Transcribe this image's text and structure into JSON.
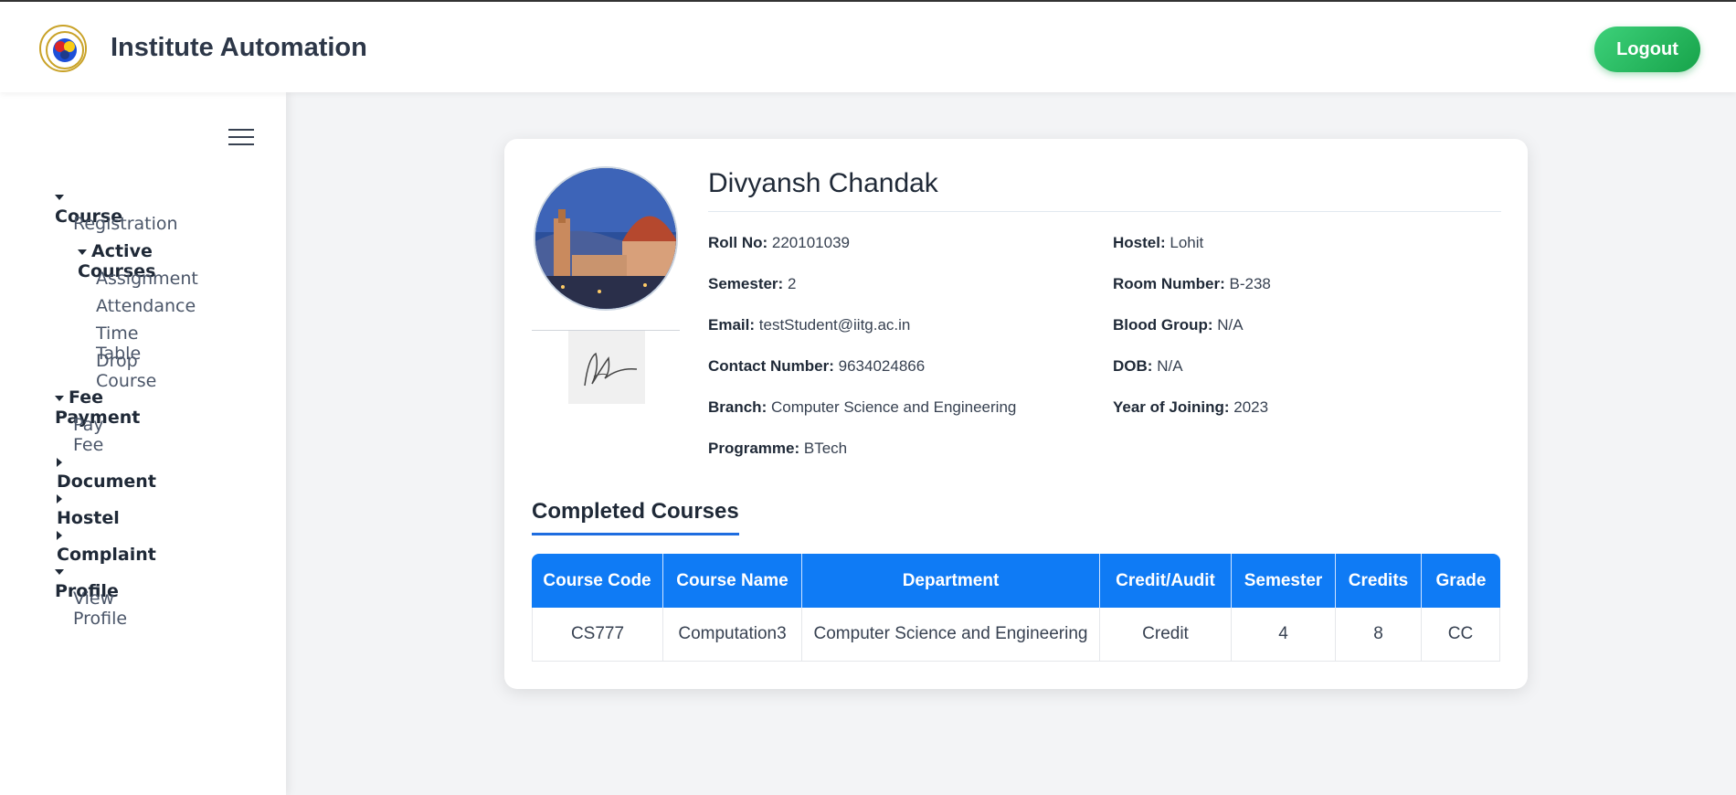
{
  "header": {
    "title": "Institute Automation",
    "logout_label": "Logout"
  },
  "sidebar": {
    "groups": [
      {
        "label": "Course",
        "expanded": true,
        "items": [
          "Registration"
        ],
        "subgroup": {
          "label": "Active Courses",
          "expanded": true,
          "items": [
            "Assignment",
            "Attendance",
            "Time Table",
            "Drop Course"
          ]
        }
      },
      {
        "label": "Fee Payment",
        "expanded": true,
        "items": [
          "Pay Fee"
        ]
      },
      {
        "label": "Document",
        "expanded": false
      },
      {
        "label": "Hostel",
        "expanded": false
      },
      {
        "label": "Complaint",
        "expanded": false
      },
      {
        "label": "Profile",
        "expanded": true,
        "items": [
          "View Profile"
        ]
      }
    ]
  },
  "profile": {
    "name": "Divyansh Chandak",
    "left_fields": [
      {
        "label": "Roll No:",
        "value": "220101039"
      },
      {
        "label": "Semester:",
        "value": "2"
      },
      {
        "label": "Email:",
        "value": "testStudent@iitg.ac.in"
      },
      {
        "label": "Contact Number:",
        "value": "9634024866"
      },
      {
        "label": "Branch:",
        "value": "Computer Science and Engineering"
      },
      {
        "label": "Programme:",
        "value": "BTech"
      }
    ],
    "right_fields": [
      {
        "label": "Hostel:",
        "value": "Lohit"
      },
      {
        "label": "Room Number:",
        "value": "B-238"
      },
      {
        "label": "Blood Group:",
        "value": "N/A"
      },
      {
        "label": "DOB:",
        "value": "N/A"
      },
      {
        "label": "Year of Joining:",
        "value": "2023"
      }
    ]
  },
  "completed_courses": {
    "title": "Completed Courses",
    "columns": [
      "Course Code",
      "Course Name",
      "Department",
      "Credit/Audit",
      "Semester",
      "Credits",
      "Grade"
    ],
    "rows": [
      [
        "CS777",
        "Computation3",
        "Computer Science and Engineering",
        "Credit",
        "4",
        "8",
        "CC"
      ]
    ]
  },
  "colors": {
    "accent": "#0f7bf5",
    "logout": "#22c55e"
  }
}
